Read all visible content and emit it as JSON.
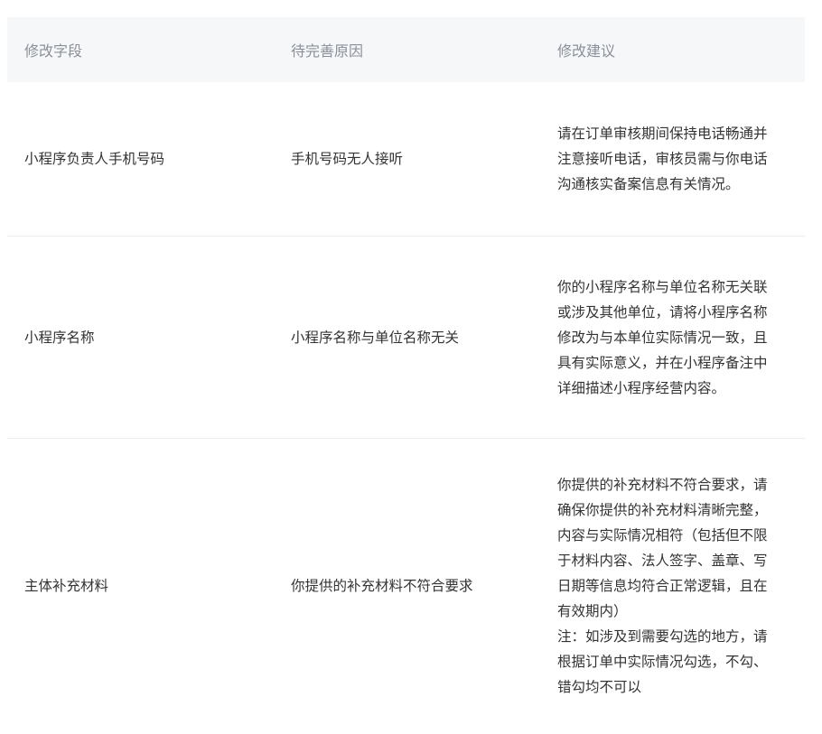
{
  "table": {
    "headers": [
      "修改字段",
      "待完善原因",
      "修改建议"
    ],
    "rows": [
      {
        "field": "小程序负责人手机号码",
        "reason": "手机号码无人接听",
        "suggestion": "请在订单审核期间保持电话畅通并\n注意接听电话，审核员需与你电话\n沟通核实备案信息有关情况。"
      },
      {
        "field": "小程序名称",
        "reason": "小程序名称与单位名称无关",
        "suggestion": "你的小程序名称与单位名称无关联\n或涉及其他单位，请将小程序名称\n修改为与本单位实际情况一致，且\n具有实际意义，并在小程序备注中\n详细描述小程序经营内容。"
      },
      {
        "field": "主体补充材料",
        "reason": "你提供的补充材料不符合要求",
        "suggestion": "你提供的补充材料不符合要求，请\n确保你提供的补充材料清晰完整，\n内容与实际情况相符（包括但不限\n于材料内容、法人签字、盖章、写\n日期等信息均符合正常逻辑，且在\n有效期内）\n注：如涉及到需要勾选的地方，请\n根据订单中实际情况勾选，不勾、\n错勾均不可以"
      }
    ]
  },
  "colors": {
    "header_bg": "#f6f7f9",
    "header_text": "#8a8f99",
    "body_text": "#333333",
    "divider": "#ececec"
  }
}
